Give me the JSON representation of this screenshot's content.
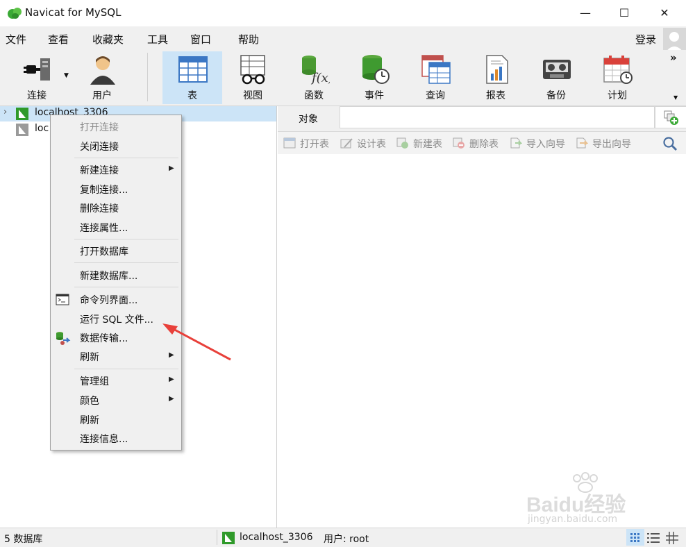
{
  "window": {
    "title": "Navicat for MySQL",
    "minimize_glyph": "—",
    "maximize_glyph": "☐",
    "close_glyph": "✕"
  },
  "menu": [
    "文件",
    "查看",
    "收藏夹",
    "工具",
    "窗口",
    "帮助"
  ],
  "login_label": "登录",
  "toolbar": {
    "items": [
      {
        "label": "连接",
        "icon": "plug-icon"
      },
      {
        "label": "用户",
        "icon": "user-icon"
      },
      {
        "label": "表",
        "icon": "table-icon"
      },
      {
        "label": "视图",
        "icon": "view-glasses-icon"
      },
      {
        "label": "函数",
        "icon": "function-icon"
      },
      {
        "label": "事件",
        "icon": "event-clock-icon"
      },
      {
        "label": "查询",
        "icon": "query-icon"
      },
      {
        "label": "报表",
        "icon": "report-icon"
      },
      {
        "label": "备份",
        "icon": "backup-tape-icon"
      },
      {
        "label": "计划",
        "icon": "calendar-icon"
      }
    ],
    "overflow": "»"
  },
  "tree": {
    "items": [
      {
        "label": "localhost_3306"
      },
      {
        "label": "loc"
      }
    ]
  },
  "context_menu": {
    "items": [
      {
        "label": "打开连接",
        "disabled": true
      },
      {
        "label": "关闭连接"
      },
      {
        "label": "新建连接"
      },
      {
        "label": "复制连接..."
      },
      {
        "label": "删除连接"
      },
      {
        "label": "连接属性..."
      },
      {
        "label": "打开数据库"
      },
      {
        "label": "新建数据库..."
      },
      {
        "label": "命令列界面..."
      },
      {
        "label": "运行 SQL 文件..."
      },
      {
        "label": "数据传输..."
      },
      {
        "label": "刷新"
      },
      {
        "label": "管理组"
      },
      {
        "label": "颜色"
      },
      {
        "label": "刷新"
      },
      {
        "label": "连接信息..."
      }
    ]
  },
  "object_tab": "对象",
  "object_toolbar": [
    "打开表",
    "设计表",
    "新建表",
    "删除表",
    "导入向导",
    "导出向导"
  ],
  "status": {
    "db_count": "5 数据库",
    "connection": "localhost_3306",
    "user": "用户: root"
  },
  "watermark": {
    "brand": "Baidu经验",
    "url": "jingyan.baidu.com"
  },
  "colors": {
    "accent": "#cce4f7",
    "navicat_green": "#3aa935",
    "arrow_red": "#e8403a"
  }
}
